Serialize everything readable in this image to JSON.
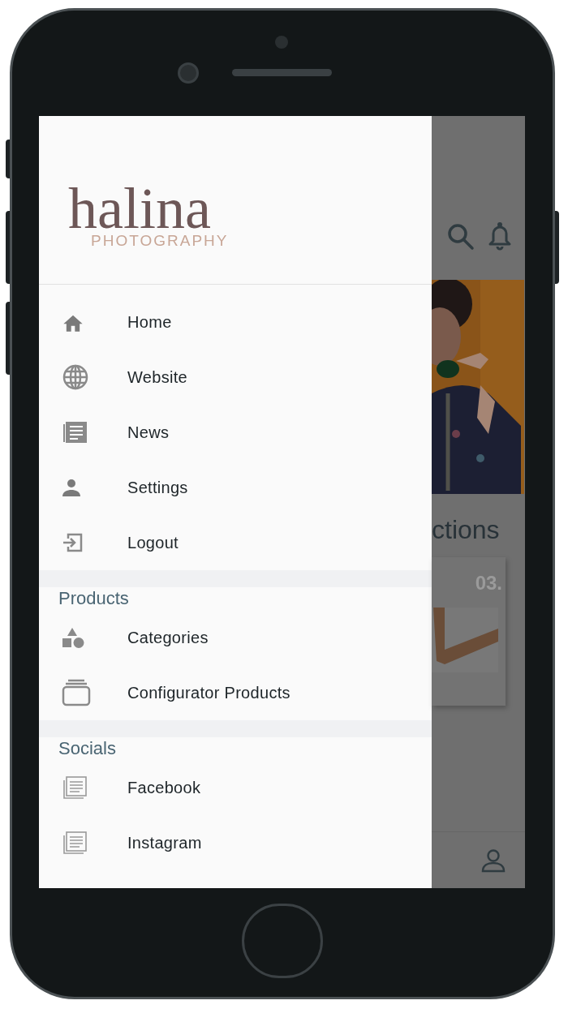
{
  "logo": {
    "name": "halina",
    "tagline": "PHOTOGRAPHY"
  },
  "menu": [
    {
      "label": "Home"
    },
    {
      "label": "Website"
    },
    {
      "label": "News"
    },
    {
      "label": "Settings"
    },
    {
      "label": "Logout"
    }
  ],
  "sections": [
    {
      "title": "Products",
      "items": [
        {
          "label": "Categories"
        },
        {
          "label": "Configurator Products"
        }
      ]
    },
    {
      "title": "Socials",
      "items": [
        {
          "label": "Facebook"
        },
        {
          "label": "Instagram"
        }
      ]
    }
  ],
  "background": {
    "heading": "ctions",
    "card_number": "03."
  }
}
